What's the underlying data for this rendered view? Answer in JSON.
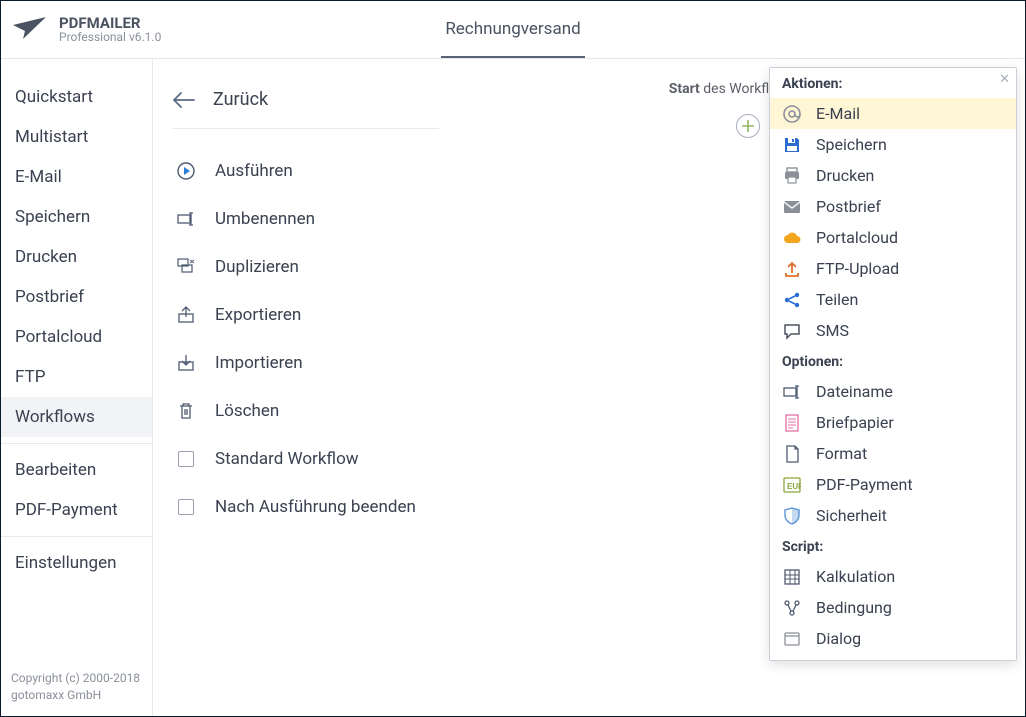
{
  "brand": {
    "title": "PDFMAILER",
    "subtitle": "Professional v6.1.0"
  },
  "header": {
    "documentName": "Rechnungversand"
  },
  "sidebar": {
    "items": [
      {
        "label": "Quickstart"
      },
      {
        "label": "Multistart"
      },
      {
        "label": "E-Mail"
      },
      {
        "label": "Speichern"
      },
      {
        "label": "Drucken"
      },
      {
        "label": "Postbrief"
      },
      {
        "label": "Portalcloud"
      },
      {
        "label": "FTP"
      },
      {
        "label": "Workflows",
        "selected": true
      }
    ],
    "lowerItems": [
      {
        "label": "Bearbeiten"
      },
      {
        "label": "PDF-Payment"
      }
    ],
    "settings": {
      "label": "Einstellungen"
    }
  },
  "commands": {
    "back": "Zurück",
    "items": [
      {
        "icon": "play",
        "label": "Ausführen"
      },
      {
        "icon": "rename",
        "label": "Umbenennen"
      },
      {
        "icon": "duplicate",
        "label": "Duplizieren"
      },
      {
        "icon": "export",
        "label": "Exportieren"
      },
      {
        "icon": "import",
        "label": "Importieren"
      },
      {
        "icon": "trash",
        "label": "Löschen"
      }
    ],
    "checks": [
      {
        "label": "Standard Workflow"
      },
      {
        "label": "Nach Ausführung beenden"
      }
    ]
  },
  "canvas": {
    "startBold": "Start",
    "startRest": " des Workflows"
  },
  "panel": {
    "sections": [
      {
        "title": "Aktionen:",
        "items": [
          {
            "label": "E-Mail",
            "icon": "at",
            "selected": true,
            "color": "#8a909a"
          },
          {
            "label": "Speichern",
            "icon": "save",
            "color": "#2a6bd4"
          },
          {
            "label": "Drucken",
            "icon": "print",
            "color": "#8a909a"
          },
          {
            "label": "Postbrief",
            "icon": "mail",
            "color": "#8a909a"
          },
          {
            "label": "Portalcloud",
            "icon": "cloud",
            "color": "#f4a51e"
          },
          {
            "label": "FTP-Upload",
            "icon": "upload",
            "color": "#e0702f"
          },
          {
            "label": "Teilen",
            "icon": "share",
            "color": "#2a6bd4"
          },
          {
            "label": "SMS",
            "icon": "chat",
            "color": "#4a5361"
          }
        ]
      },
      {
        "title": "Optionen:",
        "items": [
          {
            "label": "Dateiname",
            "icon": "filename",
            "color": "#4d5b72"
          },
          {
            "label": "Briefpapier",
            "icon": "paper",
            "color": "#e46fa3"
          },
          {
            "label": "Format",
            "icon": "page",
            "color": "#4d5b72"
          },
          {
            "label": "PDF-Payment",
            "icon": "eur",
            "color": "#8aa63b"
          },
          {
            "label": "Sicherheit",
            "icon": "shield",
            "color": "#5a94d4"
          }
        ]
      },
      {
        "title": "Script:",
        "items": [
          {
            "label": "Kalkulation",
            "icon": "table",
            "color": "#4d5b72"
          },
          {
            "label": "Bedingung",
            "icon": "branch",
            "color": "#4d5b72"
          },
          {
            "label": "Dialog",
            "icon": "dialog",
            "color": "#8a909a"
          }
        ]
      }
    ]
  },
  "footer": {
    "line1": "Copyright (c) 2000-2018",
    "line2": "gotomaxx GmbH"
  }
}
